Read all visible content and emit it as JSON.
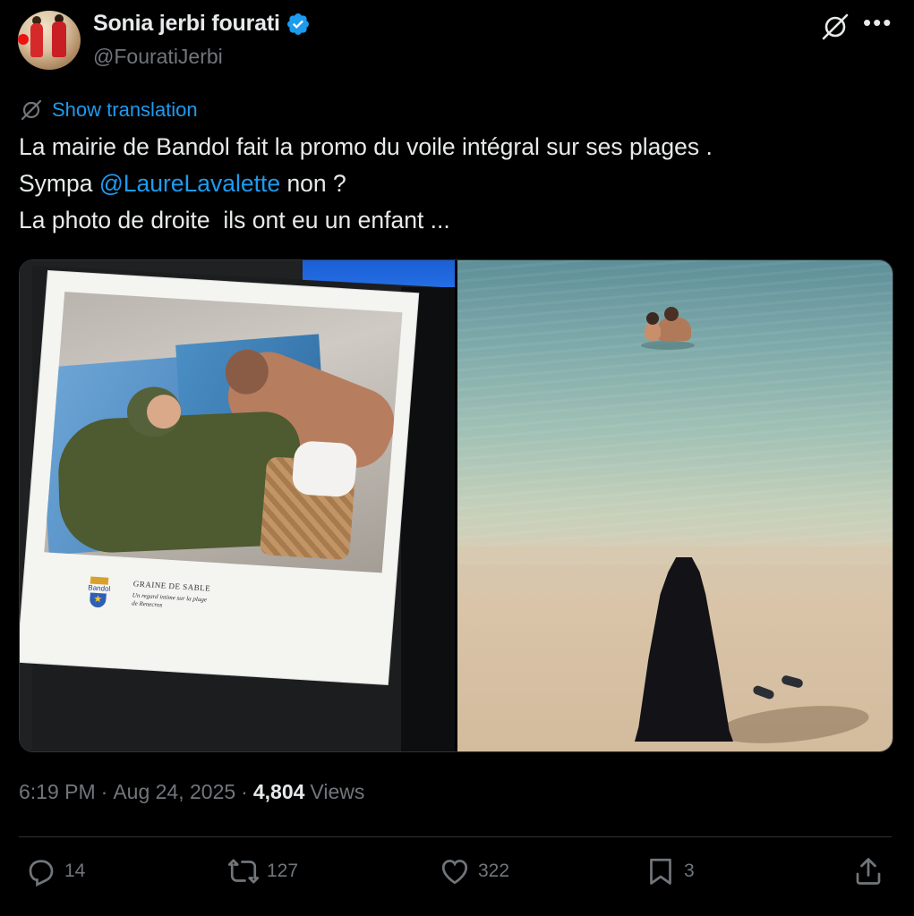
{
  "author": {
    "display_name": "Sonia jerbi fourati",
    "handle": "@FouratiJerbi",
    "verified": true
  },
  "translate": {
    "label": "Show translation"
  },
  "tweet": {
    "line1": "La mairie de Bandol fait la promo du voile intégral sur ses plages .",
    "line2_prefix": "Sympa ",
    "line2_mention": "@LaureLavalette",
    "line2_suffix": " non ?",
    "line3": "La photo de droite  ils ont eu un enfant ..."
  },
  "media": {
    "left_poster": {
      "logo_label": "Bandol",
      "title": "GRAINE DE SABLE",
      "subtitle": "Un regard intime sur la plage de Renecros"
    }
  },
  "meta": {
    "time": "6:19 PM",
    "separator": "·",
    "date": "Aug 24, 2025",
    "views_count": "4,804",
    "views_label": "Views"
  },
  "actions": {
    "replies": "14",
    "reposts": "127",
    "likes": "322",
    "bookmarks": "3"
  },
  "colors": {
    "background": "#000000",
    "text": "#e7e9ea",
    "secondary": "#71767b",
    "accent": "#1d9bf0",
    "divider": "#2f3336"
  },
  "icons": [
    "verified-badge-icon",
    "grok-icon",
    "more-icon",
    "translate-icon",
    "reply-icon",
    "repost-icon",
    "like-icon",
    "bookmark-icon",
    "share-icon"
  ]
}
